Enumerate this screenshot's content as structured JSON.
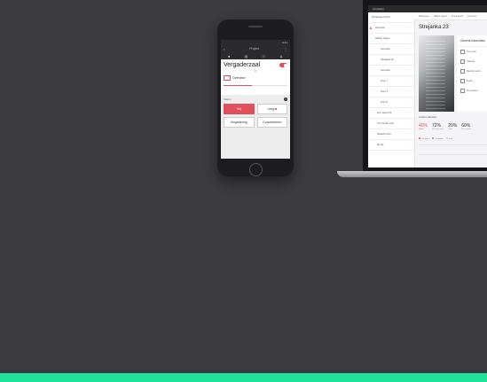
{
  "colors": {
    "background": "#3b3b3f",
    "accent": "#e0505c",
    "strip": "#1fe39a"
  },
  "phone": {
    "status_text": "9:41",
    "nav_title": "Project",
    "tabs": [
      "lightbulb-icon",
      "grid-icon",
      "dial-icon",
      "user-icon"
    ],
    "room_name": "Vergaderzaal",
    "room_sub": "Overview",
    "section_label": "Status",
    "progress": 0.45,
    "buttons": [
      {
        "label": "Vrij",
        "active": true
      },
      {
        "label": "Leeg",
        "active": false
      },
      {
        "label": "Vergadering",
        "active": false
      },
      {
        "label": "Concentreren",
        "active": false
      }
    ]
  },
  "laptop": {
    "app_title": "Company",
    "sidebar": [
      {
        "label": "Workspace Portal"
      },
      {
        "label": "Overview"
      },
      {
        "label": "Wibaut Jagers"
      },
      {
        "label": "Overview"
      },
      {
        "label": "Strejanka 23"
      },
      {
        "label": "Overview"
      },
      {
        "label": "Floor 7"
      },
      {
        "label": "Floor 6"
      },
      {
        "label": "Floor 5"
      },
      {
        "label": "D.E. Gevel 33"
      },
      {
        "label": "The Vondel Golf"
      },
      {
        "label": "Rudolph Four"
      },
      {
        "label": "My list"
      }
    ],
    "breadcrumbs": [
      "Workspace",
      "Wibaut Jagers",
      "Strejanka 23",
      "Overview"
    ],
    "page_title": "Strejanka 23",
    "general_info_title": "General information",
    "info_rows": [
      "Your team",
      "Capacity",
      "Meeting rooms",
      "Desks",
      "Flex spaces"
    ],
    "section_label": "Current utilization",
    "stats": [
      {
        "value": "40%",
        "caption": "Desks",
        "active": true
      },
      {
        "value": "72%",
        "caption": "Meeting rooms",
        "active": false
      },
      {
        "value": "20%",
        "caption": "Other",
        "active": false
      },
      {
        "value": "60%",
        "caption": "Flex spaces",
        "active": false
      }
    ],
    "legend": [
      "Occupied",
      "Reserved",
      "Free"
    ]
  }
}
